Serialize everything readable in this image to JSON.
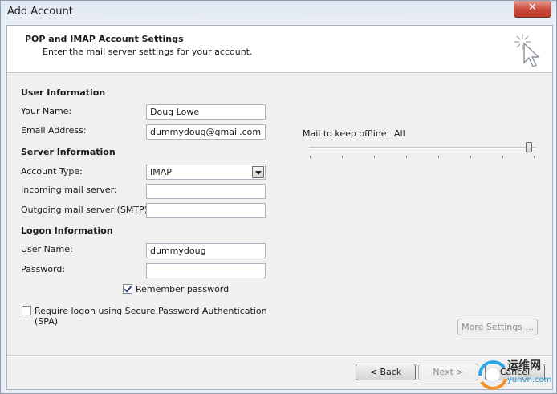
{
  "window": {
    "title": "Add Account",
    "close_glyph": "✕"
  },
  "header": {
    "title": "POP and IMAP Account Settings",
    "subtitle": "Enter the mail server settings for your account.",
    "icon": "wizard-cursor-icon"
  },
  "user_info": {
    "heading": "User Information",
    "name_label": "Your Name:",
    "name_value": "Doug Lowe",
    "email_label": "Email Address:",
    "email_value": "dummydoug@gmail.com"
  },
  "server_info": {
    "heading": "Server Information",
    "account_type_label": "Account Type:",
    "account_type_value": "IMAP",
    "incoming_label": "Incoming mail server:",
    "incoming_value": "",
    "outgoing_label": "Outgoing mail server (SMTP):",
    "outgoing_value": ""
  },
  "logon_info": {
    "heading": "Logon Information",
    "username_label": "User Name:",
    "username_value": "dummydoug",
    "password_label": "Password:",
    "password_value": "",
    "remember_label": "Remember password",
    "remember_checked": true,
    "spa_label_1": "Require logon using Secure Password Authentication",
    "spa_label_2": "(SPA)",
    "spa_checked": false
  },
  "offline": {
    "label": "Mail to keep offline:",
    "value": "All",
    "slider_position": 1.0
  },
  "buttons": {
    "more_settings": "More Settings ...",
    "back": "< Back",
    "next": "Next >",
    "cancel": "Cancel"
  },
  "watermark": {
    "text_cn": "运维网",
    "text_url": "yunvn.com"
  }
}
